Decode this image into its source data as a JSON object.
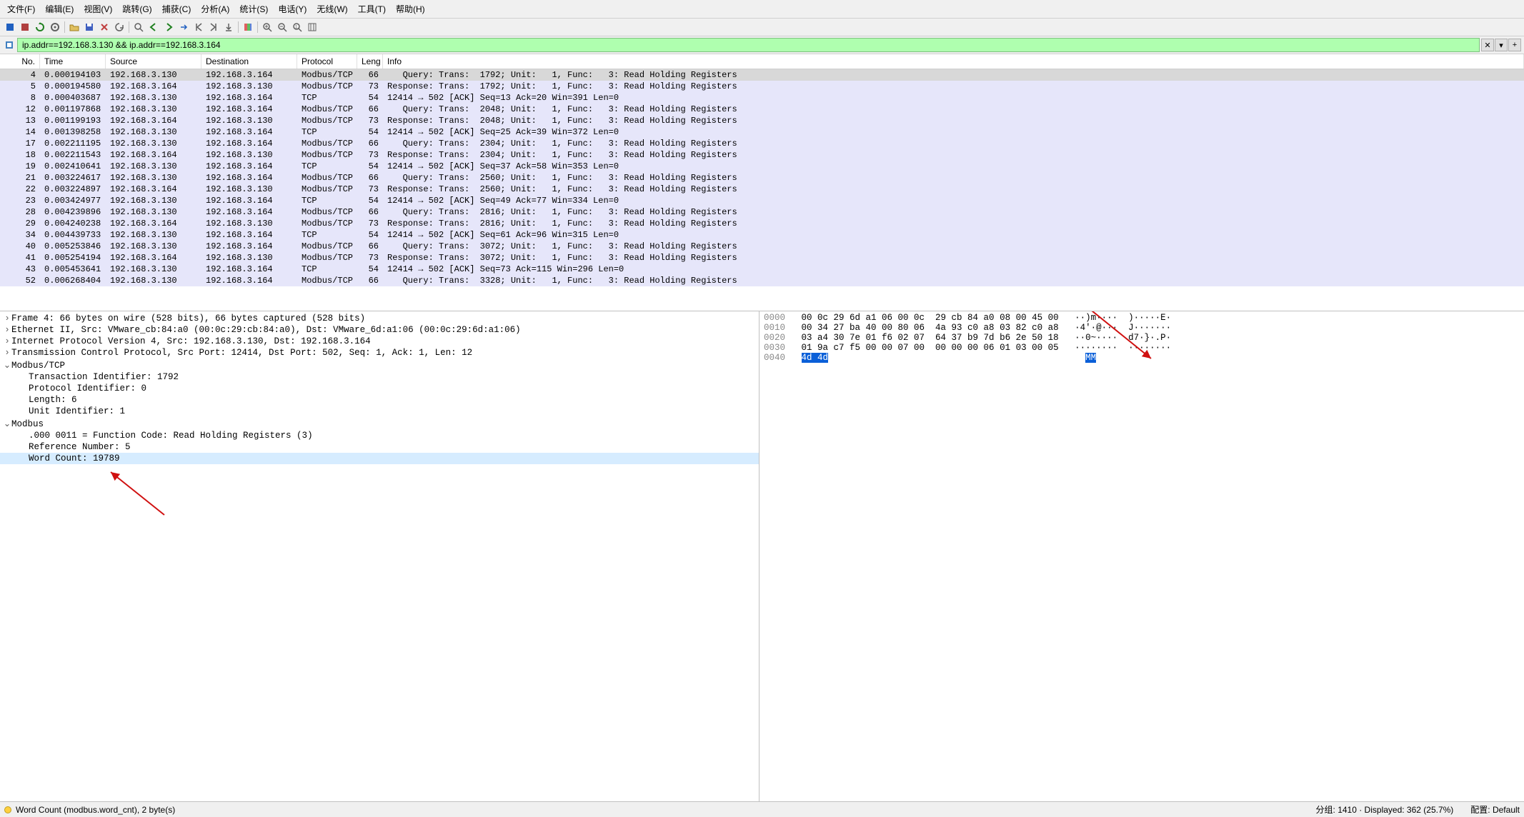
{
  "menu": [
    "文件(F)",
    "编辑(E)",
    "视图(V)",
    "跳转(G)",
    "捕获(C)",
    "分析(A)",
    "统计(S)",
    "电话(Y)",
    "无线(W)",
    "工具(T)",
    "帮助(H)"
  ],
  "filter": {
    "value": "ip.addr==192.168.3.130 && ip.addr==192.168.3.164"
  },
  "columns": [
    "No.",
    "Time",
    "Source",
    "Destination",
    "Protocol",
    "Leng",
    "Info"
  ],
  "packets": [
    {
      "no": 4,
      "time": "0.000194103",
      "src": "192.168.3.130",
      "dst": "192.168.3.164",
      "proto": "Modbus/TCP",
      "len": 66,
      "info": "   Query: Trans:  1792; Unit:   1, Func:   3: Read Holding Registers",
      "sel": true
    },
    {
      "no": 5,
      "time": "0.000194580",
      "src": "192.168.3.164",
      "dst": "192.168.3.130",
      "proto": "Modbus/TCP",
      "len": 73,
      "info": "Response: Trans:  1792; Unit:   1, Func:   3: Read Holding Registers"
    },
    {
      "no": 8,
      "time": "0.000403687",
      "src": "192.168.3.130",
      "dst": "192.168.3.164",
      "proto": "TCP",
      "len": 54,
      "info": "12414 → 502 [ACK] Seq=13 Ack=20 Win=391 Len=0"
    },
    {
      "no": 12,
      "time": "0.001197868",
      "src": "192.168.3.130",
      "dst": "192.168.3.164",
      "proto": "Modbus/TCP",
      "len": 66,
      "info": "   Query: Trans:  2048; Unit:   1, Func:   3: Read Holding Registers"
    },
    {
      "no": 13,
      "time": "0.001199193",
      "src": "192.168.3.164",
      "dst": "192.168.3.130",
      "proto": "Modbus/TCP",
      "len": 73,
      "info": "Response: Trans:  2048; Unit:   1, Func:   3: Read Holding Registers"
    },
    {
      "no": 14,
      "time": "0.001398258",
      "src": "192.168.3.130",
      "dst": "192.168.3.164",
      "proto": "TCP",
      "len": 54,
      "info": "12414 → 502 [ACK] Seq=25 Ack=39 Win=372 Len=0"
    },
    {
      "no": 17,
      "time": "0.002211195",
      "src": "192.168.3.130",
      "dst": "192.168.3.164",
      "proto": "Modbus/TCP",
      "len": 66,
      "info": "   Query: Trans:  2304; Unit:   1, Func:   3: Read Holding Registers"
    },
    {
      "no": 18,
      "time": "0.002211543",
      "src": "192.168.3.164",
      "dst": "192.168.3.130",
      "proto": "Modbus/TCP",
      "len": 73,
      "info": "Response: Trans:  2304; Unit:   1, Func:   3: Read Holding Registers"
    },
    {
      "no": 19,
      "time": "0.002410641",
      "src": "192.168.3.130",
      "dst": "192.168.3.164",
      "proto": "TCP",
      "len": 54,
      "info": "12414 → 502 [ACK] Seq=37 Ack=58 Win=353 Len=0"
    },
    {
      "no": 21,
      "time": "0.003224617",
      "src": "192.168.3.130",
      "dst": "192.168.3.164",
      "proto": "Modbus/TCP",
      "len": 66,
      "info": "   Query: Trans:  2560; Unit:   1, Func:   3: Read Holding Registers"
    },
    {
      "no": 22,
      "time": "0.003224897",
      "src": "192.168.3.164",
      "dst": "192.168.3.130",
      "proto": "Modbus/TCP",
      "len": 73,
      "info": "Response: Trans:  2560; Unit:   1, Func:   3: Read Holding Registers"
    },
    {
      "no": 23,
      "time": "0.003424977",
      "src": "192.168.3.130",
      "dst": "192.168.3.164",
      "proto": "TCP",
      "len": 54,
      "info": "12414 → 502 [ACK] Seq=49 Ack=77 Win=334 Len=0"
    },
    {
      "no": 28,
      "time": "0.004239896",
      "src": "192.168.3.130",
      "dst": "192.168.3.164",
      "proto": "Modbus/TCP",
      "len": 66,
      "info": "   Query: Trans:  2816; Unit:   1, Func:   3: Read Holding Registers"
    },
    {
      "no": 29,
      "time": "0.004240238",
      "src": "192.168.3.164",
      "dst": "192.168.3.130",
      "proto": "Modbus/TCP",
      "len": 73,
      "info": "Response: Trans:  2816; Unit:   1, Func:   3: Read Holding Registers"
    },
    {
      "no": 34,
      "time": "0.004439733",
      "src": "192.168.3.130",
      "dst": "192.168.3.164",
      "proto": "TCP",
      "len": 54,
      "info": "12414 → 502 [ACK] Seq=61 Ack=96 Win=315 Len=0"
    },
    {
      "no": 40,
      "time": "0.005253846",
      "src": "192.168.3.130",
      "dst": "192.168.3.164",
      "proto": "Modbus/TCP",
      "len": 66,
      "info": "   Query: Trans:  3072; Unit:   1, Func:   3: Read Holding Registers"
    },
    {
      "no": 41,
      "time": "0.005254194",
      "src": "192.168.3.164",
      "dst": "192.168.3.130",
      "proto": "Modbus/TCP",
      "len": 73,
      "info": "Response: Trans:  3072; Unit:   1, Func:   3: Read Holding Registers"
    },
    {
      "no": 43,
      "time": "0.005453641",
      "src": "192.168.3.130",
      "dst": "192.168.3.164",
      "proto": "TCP",
      "len": 54,
      "info": "12414 → 502 [ACK] Seq=73 Ack=115 Win=296 Len=0"
    },
    {
      "no": 52,
      "time": "0.006268404",
      "src": "192.168.3.130",
      "dst": "192.168.3.164",
      "proto": "Modbus/TCP",
      "len": 66,
      "info": "   Query: Trans:  3328; Unit:   1, Func:   3: Read Holding Registers"
    }
  ],
  "tree": [
    {
      "lvl": 0,
      "caret": ">",
      "text": "Frame 4: 66 bytes on wire (528 bits), 66 bytes captured (528 bits)"
    },
    {
      "lvl": 0,
      "caret": ">",
      "text": "Ethernet II, Src: VMware_cb:84:a0 (00:0c:29:cb:84:a0), Dst: VMware_6d:a1:06 (00:0c:29:6d:a1:06)"
    },
    {
      "lvl": 0,
      "caret": ">",
      "text": "Internet Protocol Version 4, Src: 192.168.3.130, Dst: 192.168.3.164"
    },
    {
      "lvl": 0,
      "caret": ">",
      "text": "Transmission Control Protocol, Src Port: 12414, Dst Port: 502, Seq: 1, Ack: 1, Len: 12"
    },
    {
      "lvl": 0,
      "caret": "v",
      "text": "Modbus/TCP"
    },
    {
      "lvl": 1,
      "caret": "",
      "text": "Transaction Identifier: 1792"
    },
    {
      "lvl": 1,
      "caret": "",
      "text": "Protocol Identifier: 0"
    },
    {
      "lvl": 1,
      "caret": "",
      "text": "Length: 6"
    },
    {
      "lvl": 1,
      "caret": "",
      "text": "Unit Identifier: 1"
    },
    {
      "lvl": 0,
      "caret": "v",
      "text": "Modbus"
    },
    {
      "lvl": 1,
      "caret": "",
      "text": ".000 0011 = Function Code: Read Holding Registers (3)"
    },
    {
      "lvl": 1,
      "caret": "",
      "text": "Reference Number: 5"
    },
    {
      "lvl": 1,
      "caret": "",
      "text": "Word Count: 19789",
      "sel": true
    }
  ],
  "hex": [
    {
      "off": "0000",
      "b": "00 0c 29 6d a1 06 00 0c  29 cb 84 a0 08 00 45 00",
      "a": "··)m····  )·····E·"
    },
    {
      "off": "0010",
      "b": "00 34 27 ba 40 00 80 06  4a 93 c0 a8 03 82 c0 a8",
      "a": "·4'·@···  J·······"
    },
    {
      "off": "0020",
      "b": "03 a4 30 7e 01 f6 02 07  64 37 b9 7d b6 2e 50 18",
      "a": "··0~····  d7·}·.P·"
    },
    {
      "off": "0030",
      "b": "01 9a c7 f5 00 00 07 00  00 00 00 06 01 03 00 05",
      "a": "········  ········"
    },
    {
      "off": "0040",
      "b": "4d 4d",
      "a": "MM",
      "sel": true
    }
  ],
  "status": {
    "left": "Word Count (modbus.word_cnt), 2 byte(s)",
    "mid": "分组: 1410 · Displayed: 362 (25.7%)",
    "right": "配置: Default"
  }
}
